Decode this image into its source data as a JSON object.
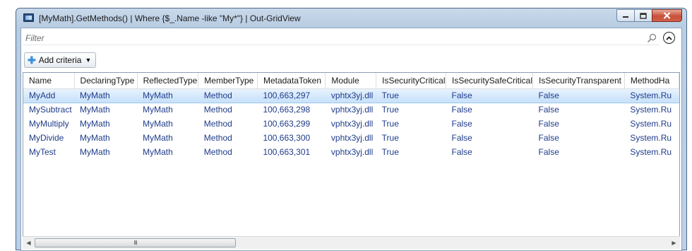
{
  "window": {
    "title": "[MyMath].GetMethods() | Where {$_.Name -like \"My*\"} | Out-GridView"
  },
  "filter": {
    "placeholder": "Filter",
    "value": ""
  },
  "add_criteria": {
    "label": "Add criteria"
  },
  "grid": {
    "columns": [
      "Name",
      "DeclaringType",
      "ReflectedType",
      "MemberType",
      "MetadataToken",
      "Module",
      "IsSecurityCritical",
      "IsSecuritySafeCritical",
      "IsSecurityTransparent",
      "MethodHa"
    ],
    "rows": [
      [
        "MyAdd",
        "MyMath",
        "MyMath",
        "Method",
        "100,663,297",
        "vphtx3yj.dll",
        "True",
        "False",
        "False",
        "System.Ru"
      ],
      [
        "MySubtract",
        "MyMath",
        "MyMath",
        "Method",
        "100,663,298",
        "vphtx3yj.dll",
        "True",
        "False",
        "False",
        "System.Ru"
      ],
      [
        "MyMultiply",
        "MyMath",
        "MyMath",
        "Method",
        "100,663,299",
        "vphtx3yj.dll",
        "True",
        "False",
        "False",
        "System.Ru"
      ],
      [
        "MyDivide",
        "MyMath",
        "MyMath",
        "Method",
        "100,663,300",
        "vphtx3yj.dll",
        "True",
        "False",
        "False",
        "System.Ru"
      ],
      [
        "MyTest",
        "MyMath",
        "MyMath",
        "Method",
        "100,663,301",
        "vphtx3yj.dll",
        "True",
        "False",
        "False",
        "System.Ru"
      ]
    ],
    "selected_row": 0
  },
  "scrollbar": {
    "grip": "III"
  },
  "colors": {
    "cell_text": "#1f3c8a",
    "selection": "#c6e0fa",
    "titlebar": "#c9d9ea",
    "close_button": "#c7503a"
  }
}
